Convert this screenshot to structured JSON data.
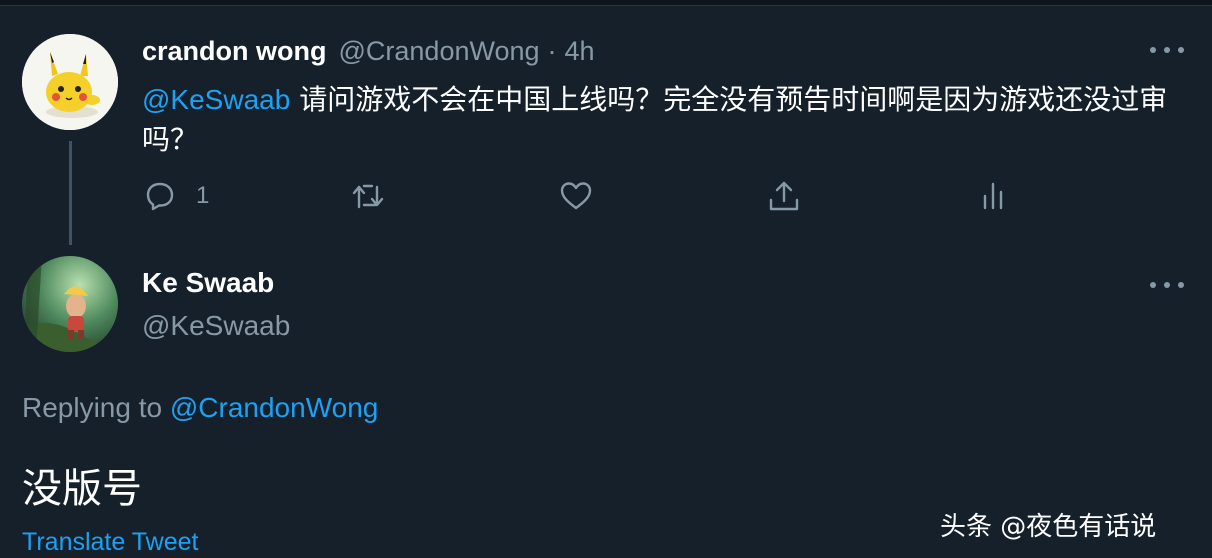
{
  "tweet": {
    "author_name": "crandon wong",
    "author_handle": "@CrandonWong",
    "separator": "·",
    "time": "4h",
    "mention": "@KeSwaab",
    "text": " 请问游戏不会在中国上线吗？完全没有预告时间啊是因为游戏还没过审吗？",
    "reply_count": "1"
  },
  "reply": {
    "author_name": "Ke Swaab",
    "author_handle": "@KeSwaab",
    "replying_prefix": "Replying to ",
    "replying_handle": "@CrandonWong",
    "text": "没版号",
    "translate_label": "Translate Tweet"
  },
  "watermark": "头条 @夜色有话说",
  "icons": {
    "reply": "reply-icon",
    "retweet": "retweet-icon",
    "like": "heart-icon",
    "share": "share-icon",
    "analytics": "analytics-icon",
    "more": "more-icon"
  },
  "colors": {
    "background": "#15202b",
    "accent": "#1da1f2",
    "secondary_text": "#8899a6"
  }
}
